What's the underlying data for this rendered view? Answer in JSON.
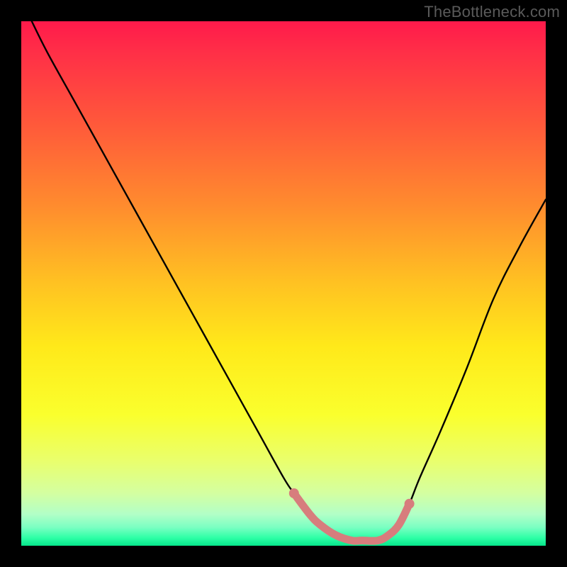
{
  "watermark": "TheBottleneck.com",
  "chart_data": {
    "type": "line",
    "title": "",
    "xlabel": "",
    "ylabel": "",
    "xlim": [
      0,
      100
    ],
    "ylim": [
      0,
      100
    ],
    "grid": false,
    "legend": false,
    "gradient_stops": [
      {
        "offset": 0.0,
        "color": "#ff1a4b"
      },
      {
        "offset": 0.06,
        "color": "#ff2f47"
      },
      {
        "offset": 0.2,
        "color": "#ff5a3a"
      },
      {
        "offset": 0.35,
        "color": "#ff8b2e"
      },
      {
        "offset": 0.5,
        "color": "#ffc222"
      },
      {
        "offset": 0.62,
        "color": "#ffe91a"
      },
      {
        "offset": 0.75,
        "color": "#faff2d"
      },
      {
        "offset": 0.84,
        "color": "#e9ff6e"
      },
      {
        "offset": 0.9,
        "color": "#d4ffa1"
      },
      {
        "offset": 0.94,
        "color": "#b2ffc7"
      },
      {
        "offset": 0.965,
        "color": "#7affc2"
      },
      {
        "offset": 0.985,
        "color": "#2dffa6"
      },
      {
        "offset": 1.0,
        "color": "#06e58b"
      }
    ],
    "series": [
      {
        "name": "bottleneck-curve",
        "color": "#000000",
        "stroke_width": 2.4,
        "x": [
          2,
          5,
          10,
          15,
          20,
          25,
          30,
          35,
          40,
          45,
          50,
          52,
          55,
          57,
          60,
          63,
          65,
          68,
          70,
          72,
          74,
          76,
          80,
          85,
          90,
          95,
          100
        ],
        "y": [
          100,
          94,
          85,
          76,
          67,
          58,
          49,
          40,
          31,
          22,
          13,
          10,
          6,
          4,
          2,
          1,
          1,
          1,
          2,
          4,
          8,
          13,
          22,
          34,
          47,
          57,
          66
        ]
      }
    ],
    "highlight_segment": {
      "name": "sweet-spot-band",
      "color": "#d77d7d",
      "stroke_width": 11,
      "x": [
        52,
        55,
        57,
        60,
        63,
        65,
        68,
        70,
        72,
        74
      ],
      "y": [
        10,
        6,
        4,
        2,
        1,
        1,
        1,
        2,
        4,
        8
      ]
    },
    "highlight_endpoints": {
      "color": "#d77d7d",
      "radius": 7,
      "points": [
        {
          "x": 52,
          "y": 10
        },
        {
          "x": 74,
          "y": 8
        }
      ]
    }
  }
}
